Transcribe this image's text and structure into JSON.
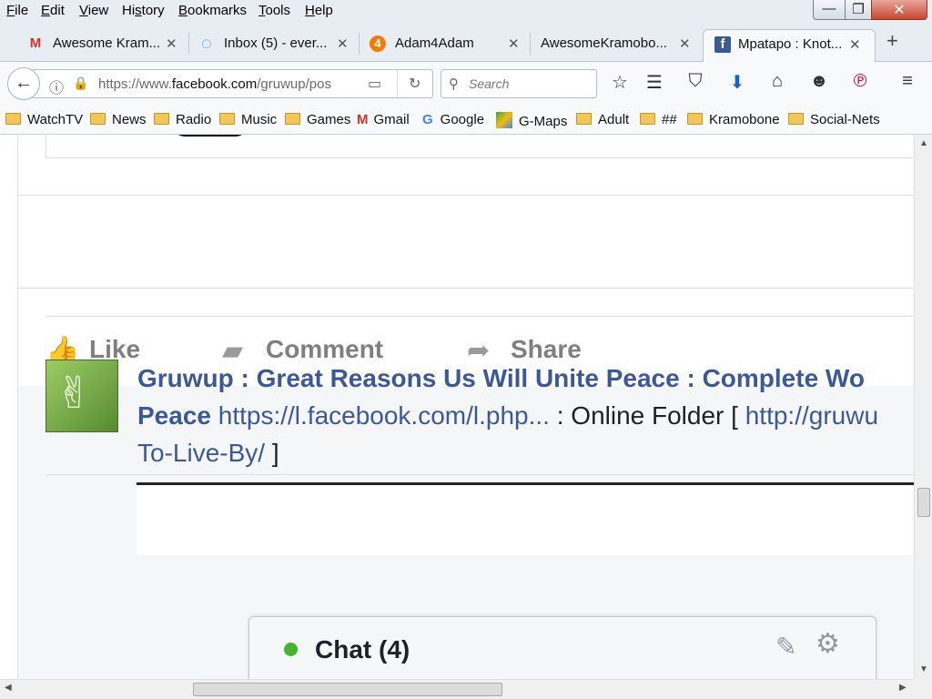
{
  "menubar": {
    "items": [
      {
        "label": "File",
        "accel": "F",
        "rest": "ile"
      },
      {
        "label": "Edit",
        "accel": "E",
        "rest": "dit"
      },
      {
        "label": "View",
        "accel": "V",
        "rest": "iew"
      },
      {
        "label": "History",
        "pre": "Hi",
        "accel": "s",
        "rest": "tory"
      },
      {
        "label": "Bookmarks",
        "accel": "B",
        "rest": "ookmarks"
      },
      {
        "label": "Tools",
        "accel": "T",
        "rest": "ools"
      },
      {
        "label": "Help",
        "accel": "H",
        "rest": "elp"
      }
    ],
    "window_controls": {
      "minimize": "—",
      "maximize": "❐",
      "close": "✕"
    }
  },
  "tabs": [
    {
      "title": "Awesome Kram...",
      "icon": "gmail-icon",
      "icon_glyph": "M",
      "icon_color": "#d93025",
      "close": "✕"
    },
    {
      "title": "Inbox (5) - ever...",
      "icon": "loading-spinner-icon",
      "icon_glyph": "◌",
      "icon_color": "#1e88e5",
      "close": "✕"
    },
    {
      "title": "Adam4Adam",
      "icon": "adam4adam-icon",
      "icon_glyph": "4",
      "icon_color": "#f57c00",
      "close": "✕"
    },
    {
      "title": "AwesomeKramobo...",
      "icon": "",
      "icon_glyph": "",
      "icon_color": "#000",
      "close": "✕"
    },
    {
      "title": "Mpatapo : Knot...",
      "icon": "facebook-icon",
      "icon_glyph": "f",
      "icon_color": "#3b5998",
      "close": "✕"
    }
  ],
  "newtab": "+",
  "navbar": {
    "url_prefix": "https://www.",
    "url_domain": "facebook.com",
    "url_suffix": "/gruwup/pos",
    "search_placeholder": "Search"
  },
  "bookmarks": [
    {
      "label": "WatchTV",
      "type": "folder"
    },
    {
      "label": "News",
      "type": "folder"
    },
    {
      "label": "Radio",
      "type": "folder"
    },
    {
      "label": "Music",
      "type": "folder"
    },
    {
      "label": "Games",
      "type": "folder"
    },
    {
      "label": "Gmail",
      "type": "gmail"
    },
    {
      "label": "Google",
      "type": "google"
    },
    {
      "label": "G-Maps",
      "type": "maps"
    },
    {
      "label": "Adult",
      "type": "folder"
    },
    {
      "label": "##",
      "type": "folder"
    },
    {
      "label": "Kramobone",
      "type": "folder"
    },
    {
      "label": "Social-Nets",
      "type": "folder"
    }
  ],
  "post_actions": {
    "like": "Like",
    "comment": "Comment",
    "share": "Share"
  },
  "post": {
    "title": "Gruwup : Great Reasons Us Will Unite Peace : Complete Wo",
    "title_line2": "Peace",
    "link": "https://l.facebook.com/l.php...",
    "plain": " : Online Folder [ ",
    "link2": "http://gruwu",
    "link2_line2": "To-Live-By/",
    "close_bracket": " ]"
  },
  "chat": {
    "label": "Chat (4)",
    "status_color": "#42b72a"
  }
}
